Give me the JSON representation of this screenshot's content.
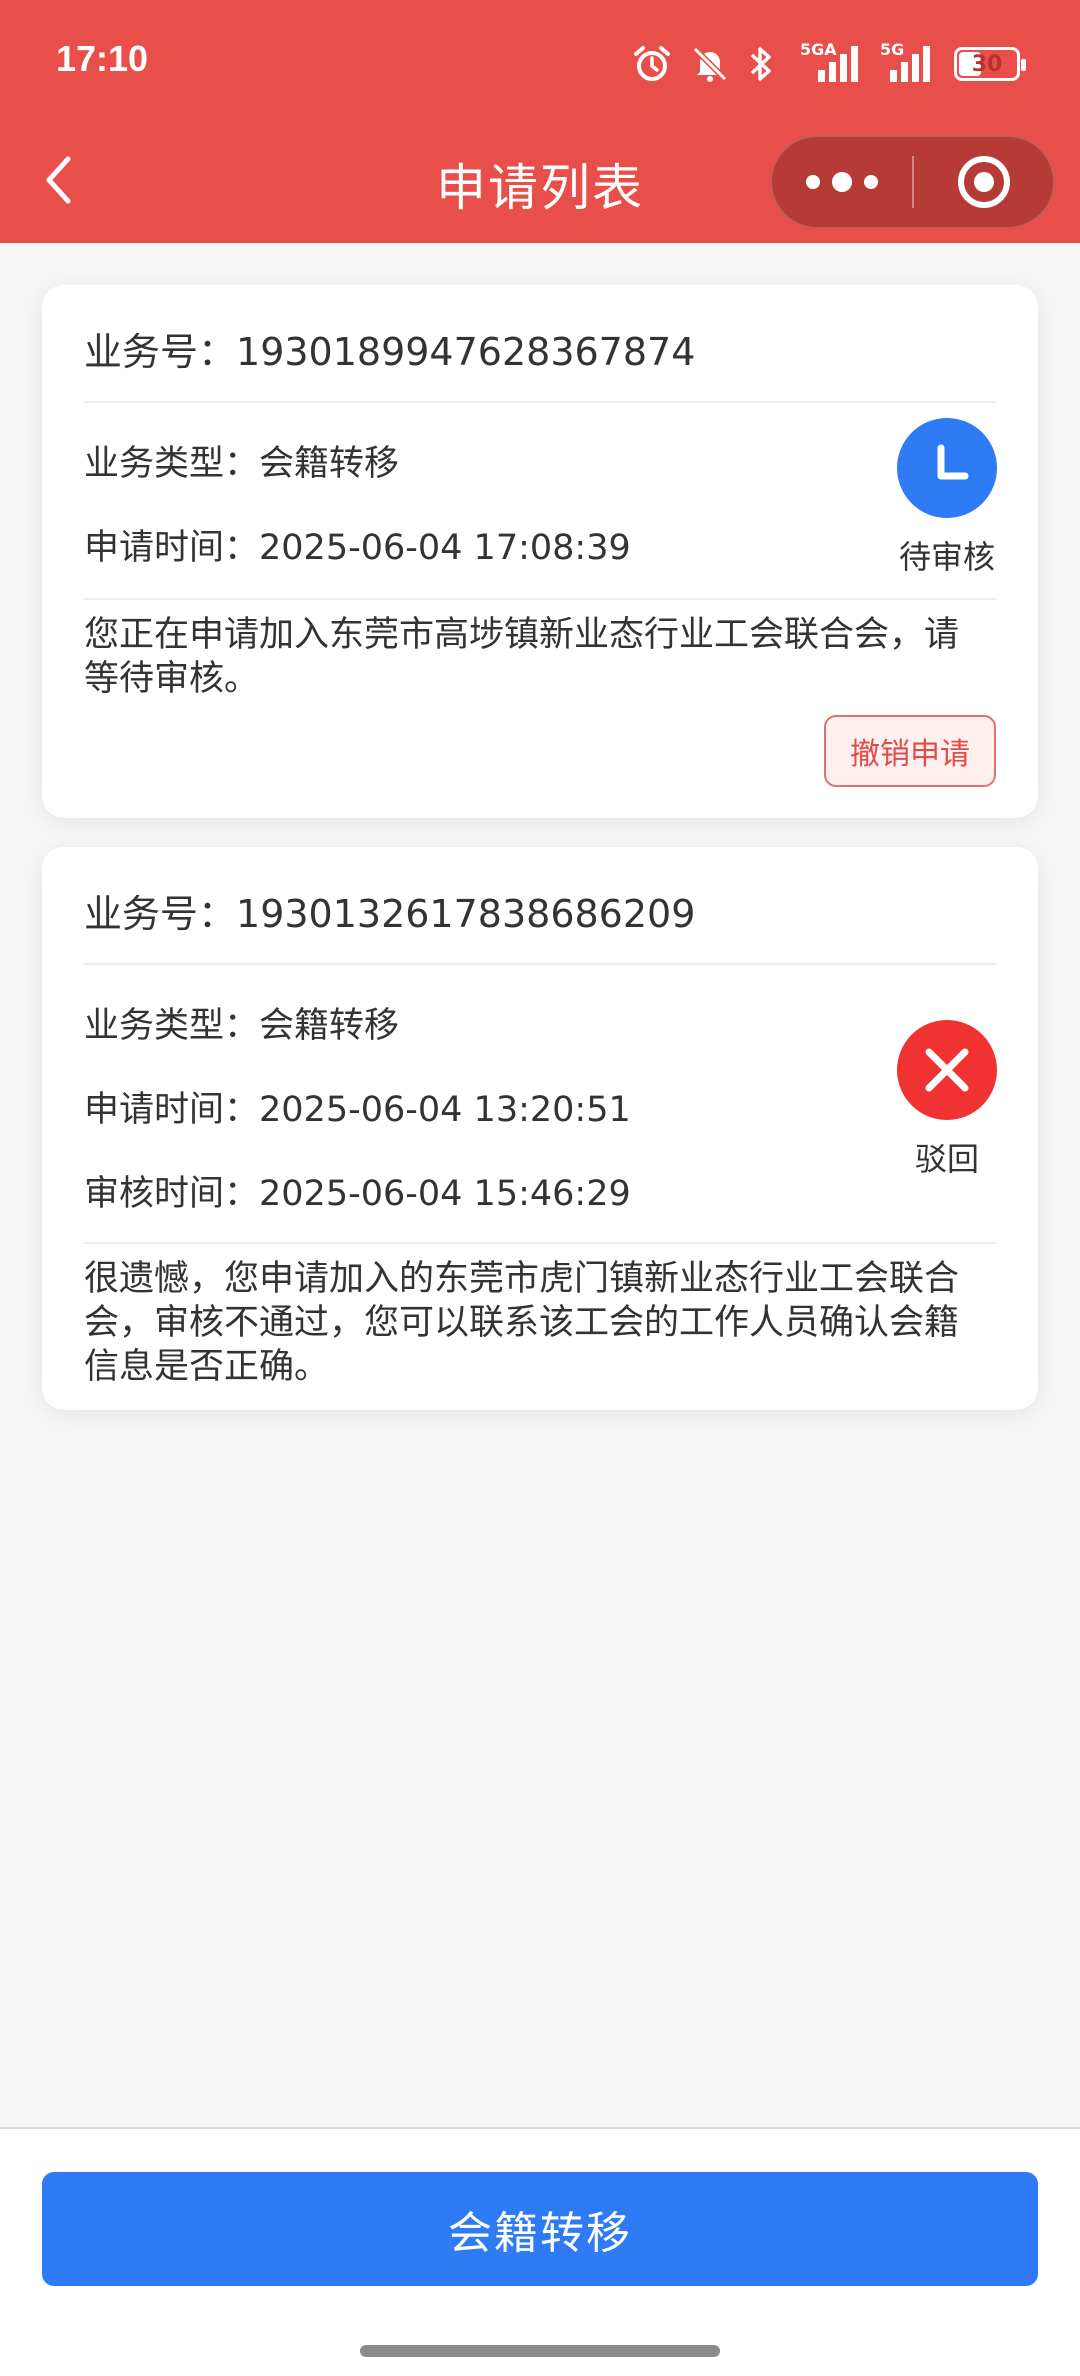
{
  "status_bar": {
    "time": "17:10",
    "network1": "5GA",
    "network2": "5G",
    "battery": "30"
  },
  "nav": {
    "title": "申请列表"
  },
  "applications": [
    {
      "business_no_label": "业务号：",
      "business_no": "1930189947628367874",
      "type_label": "业务类型：",
      "type": "会籍转移",
      "apply_time_label": "申请时间：",
      "apply_time": "2025-06-04 17:08:39",
      "status": "待审核",
      "status_color": "#2f7bf6",
      "message": "您正在申请加入东莞市高埗镇新业态行业工会联合会，请等待审核。",
      "cancel_label": "撤销申请"
    },
    {
      "business_no_label": "业务号：",
      "business_no": "1930132617838686209",
      "type_label": "业务类型：",
      "type": "会籍转移",
      "apply_time_label": "申请时间：",
      "apply_time": "2025-06-04 13:20:51",
      "review_time_label": "审核时间：",
      "review_time": "2025-06-04 15:46:29",
      "status": "驳回",
      "status_color": "#f03232",
      "message": "很遗憾，您申请加入的东莞市虎门镇新业态行业工会联合会，审核不通过，您可以联系该工会的工作人员确认会籍信息是否正确。"
    }
  ],
  "footer": {
    "button_label": "会籍转移"
  }
}
